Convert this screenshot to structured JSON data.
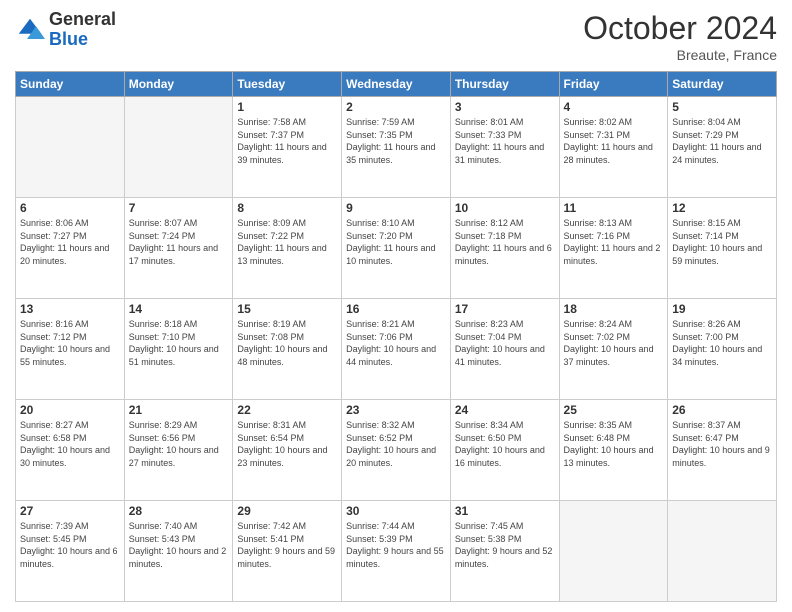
{
  "header": {
    "logo_general": "General",
    "logo_blue": "Blue",
    "month_title": "October 2024",
    "location": "Breaute, France"
  },
  "days_of_week": [
    "Sunday",
    "Monday",
    "Tuesday",
    "Wednesday",
    "Thursday",
    "Friday",
    "Saturday"
  ],
  "weeks": [
    [
      {
        "num": "",
        "sunrise": "",
        "sunset": "",
        "daylight": "",
        "empty": true
      },
      {
        "num": "",
        "sunrise": "",
        "sunset": "",
        "daylight": "",
        "empty": true
      },
      {
        "num": "1",
        "sunrise": "Sunrise: 7:58 AM",
        "sunset": "Sunset: 7:37 PM",
        "daylight": "Daylight: 11 hours and 39 minutes."
      },
      {
        "num": "2",
        "sunrise": "Sunrise: 7:59 AM",
        "sunset": "Sunset: 7:35 PM",
        "daylight": "Daylight: 11 hours and 35 minutes."
      },
      {
        "num": "3",
        "sunrise": "Sunrise: 8:01 AM",
        "sunset": "Sunset: 7:33 PM",
        "daylight": "Daylight: 11 hours and 31 minutes."
      },
      {
        "num": "4",
        "sunrise": "Sunrise: 8:02 AM",
        "sunset": "Sunset: 7:31 PM",
        "daylight": "Daylight: 11 hours and 28 minutes."
      },
      {
        "num": "5",
        "sunrise": "Sunrise: 8:04 AM",
        "sunset": "Sunset: 7:29 PM",
        "daylight": "Daylight: 11 hours and 24 minutes."
      }
    ],
    [
      {
        "num": "6",
        "sunrise": "Sunrise: 8:06 AM",
        "sunset": "Sunset: 7:27 PM",
        "daylight": "Daylight: 11 hours and 20 minutes."
      },
      {
        "num": "7",
        "sunrise": "Sunrise: 8:07 AM",
        "sunset": "Sunset: 7:24 PM",
        "daylight": "Daylight: 11 hours and 17 minutes."
      },
      {
        "num": "8",
        "sunrise": "Sunrise: 8:09 AM",
        "sunset": "Sunset: 7:22 PM",
        "daylight": "Daylight: 11 hours and 13 minutes."
      },
      {
        "num": "9",
        "sunrise": "Sunrise: 8:10 AM",
        "sunset": "Sunset: 7:20 PM",
        "daylight": "Daylight: 11 hours and 10 minutes."
      },
      {
        "num": "10",
        "sunrise": "Sunrise: 8:12 AM",
        "sunset": "Sunset: 7:18 PM",
        "daylight": "Daylight: 11 hours and 6 minutes."
      },
      {
        "num": "11",
        "sunrise": "Sunrise: 8:13 AM",
        "sunset": "Sunset: 7:16 PM",
        "daylight": "Daylight: 11 hours and 2 minutes."
      },
      {
        "num": "12",
        "sunrise": "Sunrise: 8:15 AM",
        "sunset": "Sunset: 7:14 PM",
        "daylight": "Daylight: 10 hours and 59 minutes."
      }
    ],
    [
      {
        "num": "13",
        "sunrise": "Sunrise: 8:16 AM",
        "sunset": "Sunset: 7:12 PM",
        "daylight": "Daylight: 10 hours and 55 minutes."
      },
      {
        "num": "14",
        "sunrise": "Sunrise: 8:18 AM",
        "sunset": "Sunset: 7:10 PM",
        "daylight": "Daylight: 10 hours and 51 minutes."
      },
      {
        "num": "15",
        "sunrise": "Sunrise: 8:19 AM",
        "sunset": "Sunset: 7:08 PM",
        "daylight": "Daylight: 10 hours and 48 minutes."
      },
      {
        "num": "16",
        "sunrise": "Sunrise: 8:21 AM",
        "sunset": "Sunset: 7:06 PM",
        "daylight": "Daylight: 10 hours and 44 minutes."
      },
      {
        "num": "17",
        "sunrise": "Sunrise: 8:23 AM",
        "sunset": "Sunset: 7:04 PM",
        "daylight": "Daylight: 10 hours and 41 minutes."
      },
      {
        "num": "18",
        "sunrise": "Sunrise: 8:24 AM",
        "sunset": "Sunset: 7:02 PM",
        "daylight": "Daylight: 10 hours and 37 minutes."
      },
      {
        "num": "19",
        "sunrise": "Sunrise: 8:26 AM",
        "sunset": "Sunset: 7:00 PM",
        "daylight": "Daylight: 10 hours and 34 minutes."
      }
    ],
    [
      {
        "num": "20",
        "sunrise": "Sunrise: 8:27 AM",
        "sunset": "Sunset: 6:58 PM",
        "daylight": "Daylight: 10 hours and 30 minutes."
      },
      {
        "num": "21",
        "sunrise": "Sunrise: 8:29 AM",
        "sunset": "Sunset: 6:56 PM",
        "daylight": "Daylight: 10 hours and 27 minutes."
      },
      {
        "num": "22",
        "sunrise": "Sunrise: 8:31 AM",
        "sunset": "Sunset: 6:54 PM",
        "daylight": "Daylight: 10 hours and 23 minutes."
      },
      {
        "num": "23",
        "sunrise": "Sunrise: 8:32 AM",
        "sunset": "Sunset: 6:52 PM",
        "daylight": "Daylight: 10 hours and 20 minutes."
      },
      {
        "num": "24",
        "sunrise": "Sunrise: 8:34 AM",
        "sunset": "Sunset: 6:50 PM",
        "daylight": "Daylight: 10 hours and 16 minutes."
      },
      {
        "num": "25",
        "sunrise": "Sunrise: 8:35 AM",
        "sunset": "Sunset: 6:48 PM",
        "daylight": "Daylight: 10 hours and 13 minutes."
      },
      {
        "num": "26",
        "sunrise": "Sunrise: 8:37 AM",
        "sunset": "Sunset: 6:47 PM",
        "daylight": "Daylight: 10 hours and 9 minutes."
      }
    ],
    [
      {
        "num": "27",
        "sunrise": "Sunrise: 7:39 AM",
        "sunset": "Sunset: 5:45 PM",
        "daylight": "Daylight: 10 hours and 6 minutes."
      },
      {
        "num": "28",
        "sunrise": "Sunrise: 7:40 AM",
        "sunset": "Sunset: 5:43 PM",
        "daylight": "Daylight: 10 hours and 2 minutes."
      },
      {
        "num": "29",
        "sunrise": "Sunrise: 7:42 AM",
        "sunset": "Sunset: 5:41 PM",
        "daylight": "Daylight: 9 hours and 59 minutes."
      },
      {
        "num": "30",
        "sunrise": "Sunrise: 7:44 AM",
        "sunset": "Sunset: 5:39 PM",
        "daylight": "Daylight: 9 hours and 55 minutes."
      },
      {
        "num": "31",
        "sunrise": "Sunrise: 7:45 AM",
        "sunset": "Sunset: 5:38 PM",
        "daylight": "Daylight: 9 hours and 52 minutes."
      },
      {
        "num": "",
        "sunrise": "",
        "sunset": "",
        "daylight": "",
        "empty": true
      },
      {
        "num": "",
        "sunrise": "",
        "sunset": "",
        "daylight": "",
        "empty": true
      }
    ]
  ]
}
